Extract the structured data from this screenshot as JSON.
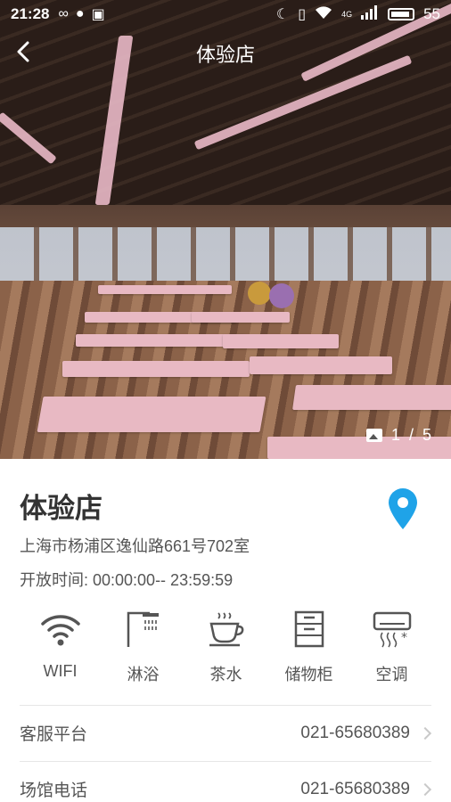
{
  "status_bar": {
    "time": "21:28",
    "battery_level": "55",
    "network_badge": "4G"
  },
  "header": {
    "title": "体验店",
    "back_icon": "back-arrow-icon"
  },
  "gallery": {
    "current": "1",
    "separator": "/",
    "total": "5"
  },
  "store": {
    "name": "体验店",
    "address": "上海市杨浦区逸仙路661号702室",
    "hours": "开放时间: 00:00:00-- 23:59:59",
    "location_icon_color": "#1fa3e8"
  },
  "facilities": [
    {
      "icon": "wifi-icon",
      "label": "WIFI"
    },
    {
      "icon": "shower-icon",
      "label": "淋浴"
    },
    {
      "icon": "tea-icon",
      "label": "茶水"
    },
    {
      "icon": "locker-icon",
      "label": "储物柜"
    },
    {
      "icon": "air-conditioner-icon",
      "label": "空调"
    }
  ],
  "contacts": [
    {
      "label": "客服平台",
      "value": "021-65680389"
    },
    {
      "label": "场馆电话",
      "value": "021-65680389"
    }
  ]
}
